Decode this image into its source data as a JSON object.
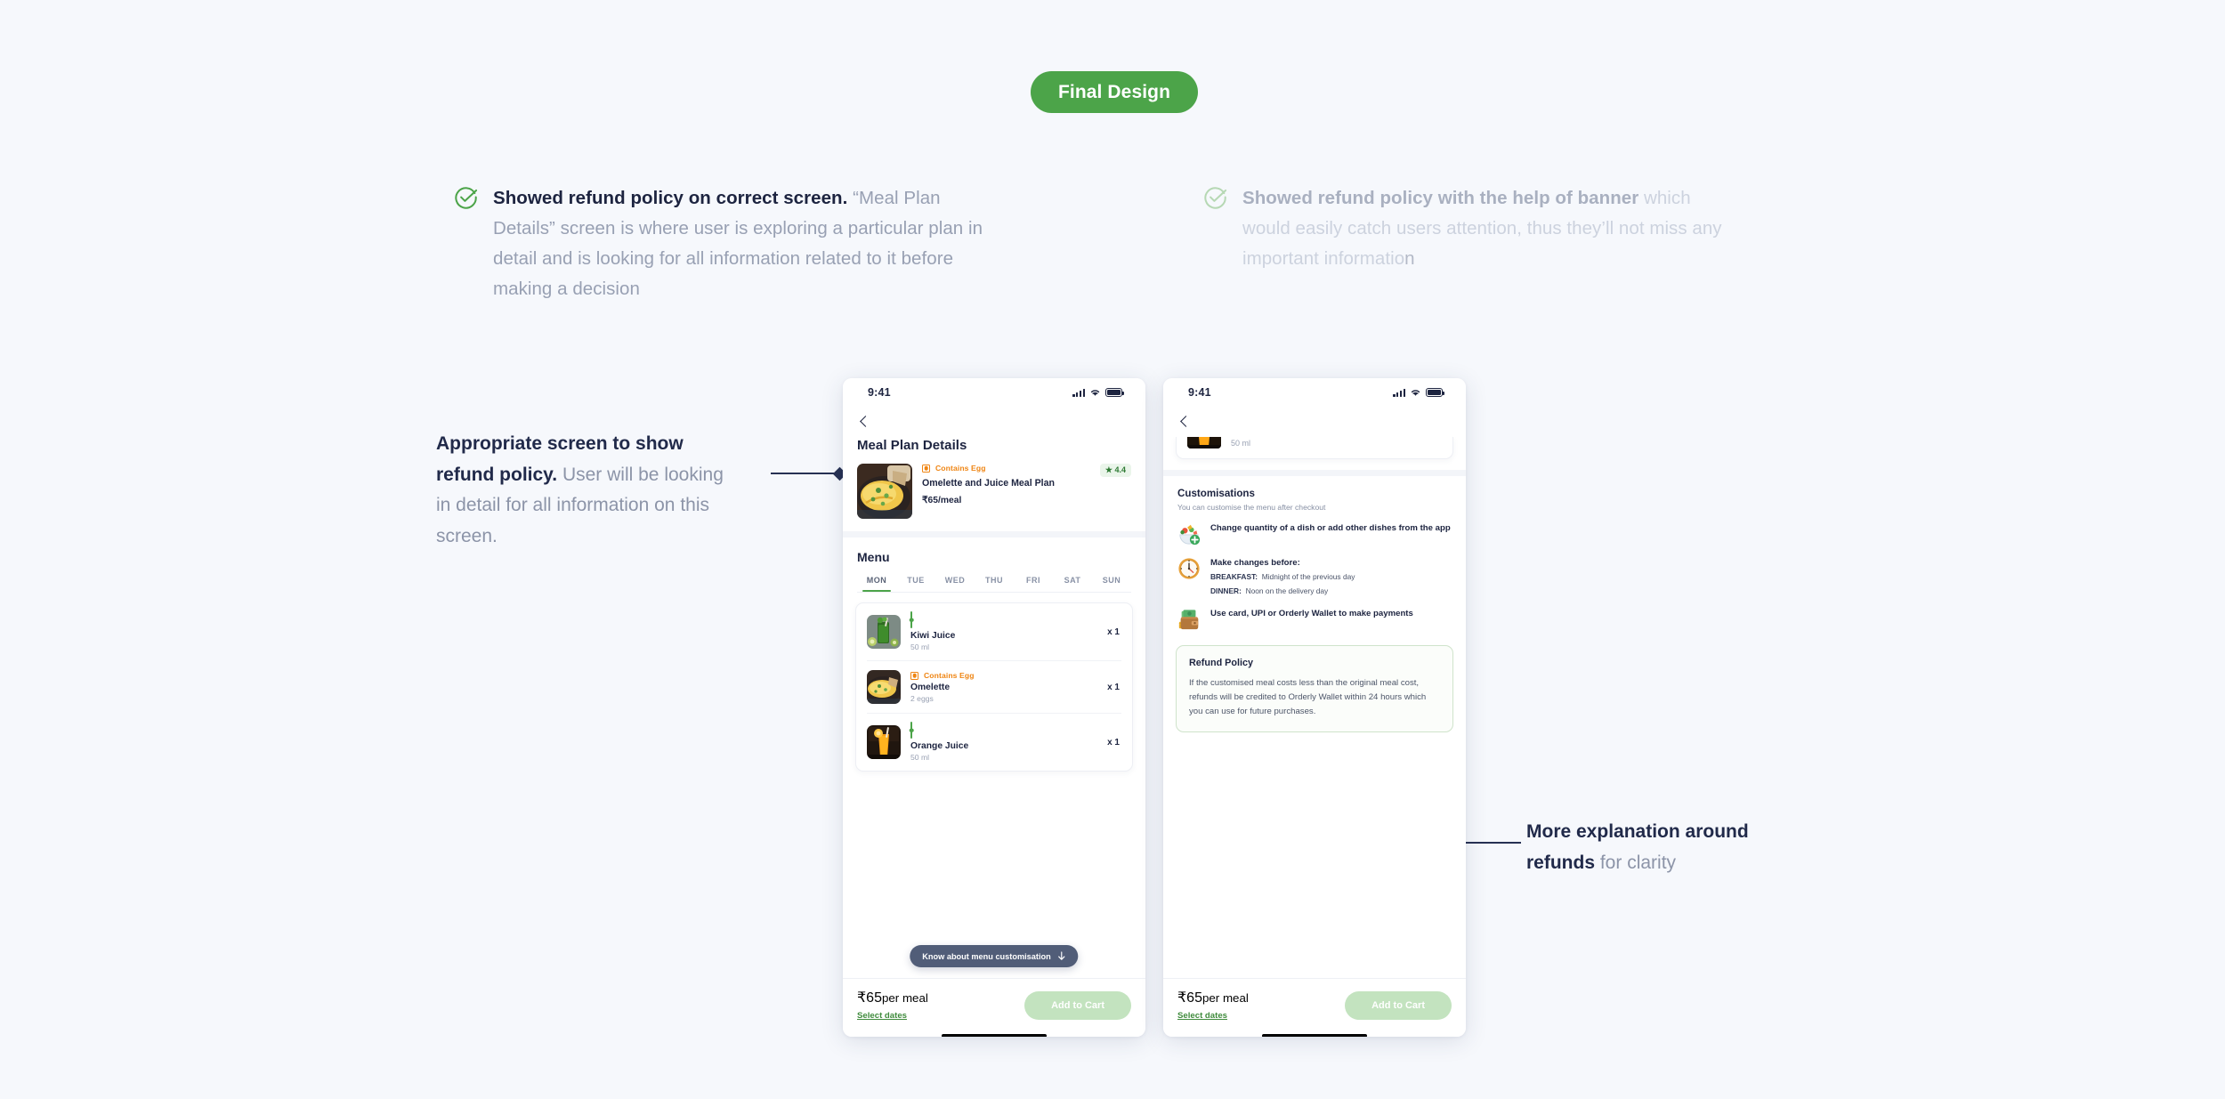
{
  "header": {
    "badge": "Final Design"
  },
  "callouts": [
    {
      "icon": "check-circle-icon",
      "bold": "Showed refund policy on correct screen.",
      "rest": " “Meal Plan Details” screen is where user is exploring a particular plan in detail and is looking for all information related to it before making a decision"
    },
    {
      "icon": "check-circle-icon",
      "bold": "Showed refund policy with the help of banner",
      "rest": " which would easily catch users attention, thus they’ll not miss any important informatio",
      "tail": "n"
    }
  ],
  "annotations": {
    "left": {
      "bold": "Appropriate screen to show refund policy.",
      "rest": " User will be looking in detail for all information on this screen."
    },
    "right": {
      "bold": "More explanation around refunds",
      "rest": " for clarity"
    }
  },
  "phone1": {
    "status": {
      "time": "9:41",
      "signal": "cellular-bars-icon",
      "wifi": "wifi-icon",
      "battery": "battery-icon"
    },
    "nav": {
      "back": "back-chevron-icon"
    },
    "title": "Meal Plan Details",
    "plan": {
      "thumb": "omelette-photo",
      "diet_mark": "egg-mark-icon",
      "diet_label": "Contains Egg",
      "name": "Omelette and Juice Meal Plan",
      "price": "₹65/meal",
      "rating": "4.4",
      "rating_star": "★"
    },
    "menu": {
      "title": "Menu",
      "days": [
        "MON",
        "TUE",
        "WED",
        "THU",
        "FRI",
        "SAT",
        "SUN"
      ],
      "active_day": "MON",
      "items": [
        {
          "thumb": "kiwi-juice-photo",
          "diet": "veg",
          "diet_label": "",
          "name": "Kiwi Juice",
          "sub": "50 ml",
          "qty": "x 1"
        },
        {
          "thumb": "omelette-photo",
          "diet": "egg",
          "diet_label": "Contains Egg",
          "name": "Omelette",
          "sub": "2 eggs",
          "qty": "x 1"
        },
        {
          "thumb": "orange-juice-photo",
          "diet": "veg",
          "diet_label": "",
          "name": "Orange Juice",
          "sub": "50 ml",
          "qty": "x 1"
        }
      ]
    },
    "know_pill": {
      "label": "Know about menu customisation",
      "icon": "arrow-down-icon"
    },
    "bottom": {
      "price": "₹65",
      "price_unit": "per meal",
      "link": "Select dates",
      "cta": "Add to Cart"
    }
  },
  "phone2": {
    "status": {
      "time": "9:41",
      "signal": "cellular-bars-icon",
      "wifi": "wifi-icon",
      "battery": "battery-icon"
    },
    "nav": {
      "back": "back-chevron-icon"
    },
    "clipped_item": {
      "thumb": "orange-juice-photo",
      "sub": "50 ml"
    },
    "customisations": {
      "title": "Customisations",
      "subtitle": "You can customise the menu after checkout",
      "items": [
        {
          "icon": "salad-plus-emoji",
          "text": "Change quantity of a dish or add other dishes from the app"
        },
        {
          "icon": "clock-emoji",
          "text": "Make changes before:",
          "rows": [
            {
              "label": "BREAKFAST:",
              "value": "Midnight of the previous day"
            },
            {
              "label": "DINNER:",
              "value": "Noon on the delivery day"
            }
          ]
        },
        {
          "icon": "wallet-emoji",
          "text": "Use card, UPI or Orderly Wallet to make payments"
        }
      ]
    },
    "refund": {
      "title": "Refund Policy",
      "body": "If the customised meal costs less than the original meal cost, refunds will be credited to Orderly Wallet within 24 hours which you can use for future purchases."
    },
    "bottom": {
      "price": "₹65",
      "price_unit": "per meal",
      "link": "Select dates",
      "cta": "Add to Cart"
    }
  },
  "colors": {
    "page_bg": "#f6f8fc",
    "brand_green": "#4ca449",
    "accent_orange": "#ef8513",
    "ink": "#1d2440",
    "muted": "#8c94a8",
    "cta_disabled": "#c3e3bf",
    "refund_border": "#cfe3cb"
  }
}
